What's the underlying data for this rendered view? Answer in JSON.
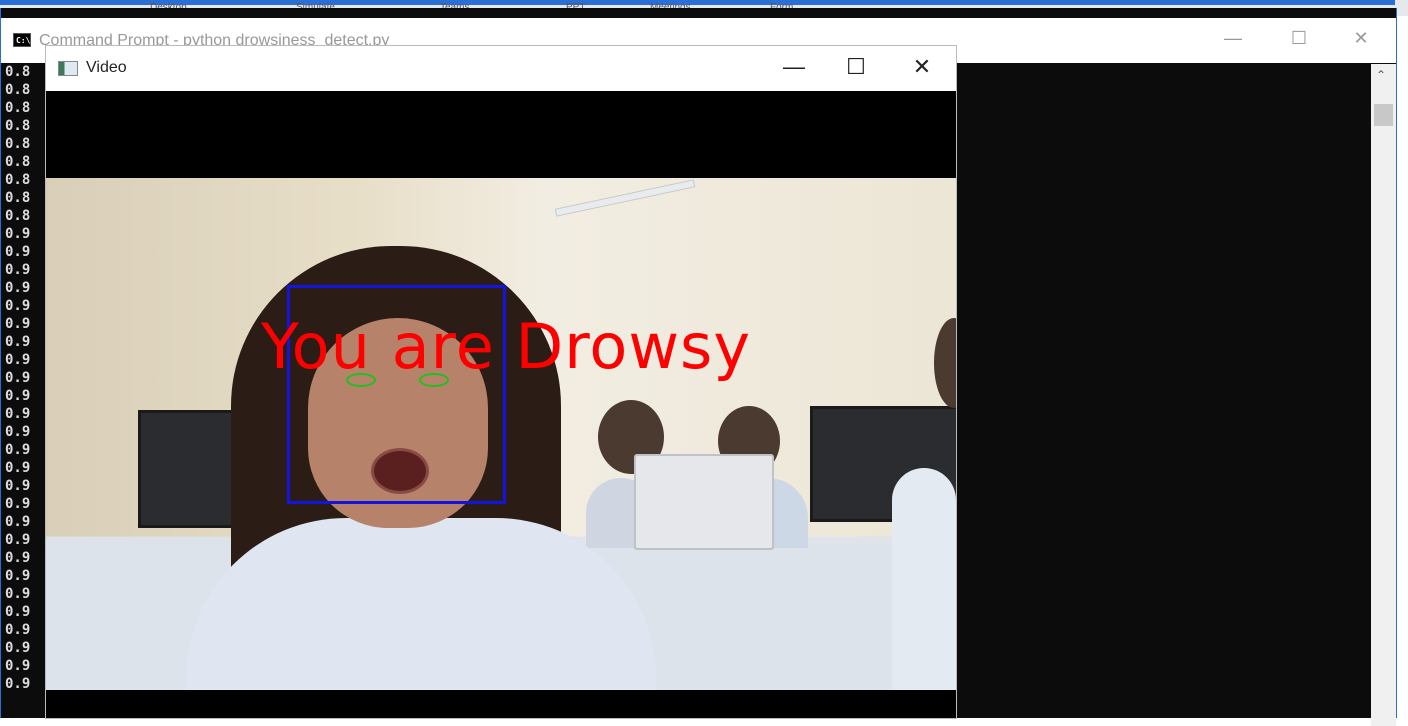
{
  "background": {
    "tabs": [
      "Desktop",
      "Simulate",
      "Teams",
      "PPT",
      "Meetings",
      "Form"
    ]
  },
  "cmd_window": {
    "title": "Command Prompt - python  drowsiness_detect.py",
    "icon": "cmd-icon",
    "icon_text": "C:\\",
    "controls": {
      "minimize": "—",
      "maximize": "☐",
      "close": "✕"
    },
    "lines": [
      "0.8",
      "0.8",
      "0.8",
      "0.8",
      "0.8",
      "0.8",
      "0.8",
      "0.8",
      "0.8",
      "0.9",
      "0.9",
      "0.9",
      "0.9",
      "0.9",
      "0.9",
      "0.9",
      "0.9",
      "0.9",
      "0.9",
      "0.9",
      "0.9",
      "0.9",
      "0.9",
      "0.9",
      "0.9",
      "0.9",
      "0.9",
      "0.9",
      "0.9",
      "0.9",
      "0.9",
      "0.9",
      "0.9",
      "0.9",
      "0.9"
    ],
    "scrollbar": {
      "up_arrow": "⌃"
    }
  },
  "video_window": {
    "title": "Video",
    "icon": "video-app-icon",
    "controls": {
      "minimize": "—",
      "maximize": "☐",
      "close": "✕"
    },
    "alert_text": "You are Drowsy",
    "colors": {
      "face_box": "#1414e0",
      "alert": "#ff0000",
      "eye_contour": "#20c020"
    }
  }
}
